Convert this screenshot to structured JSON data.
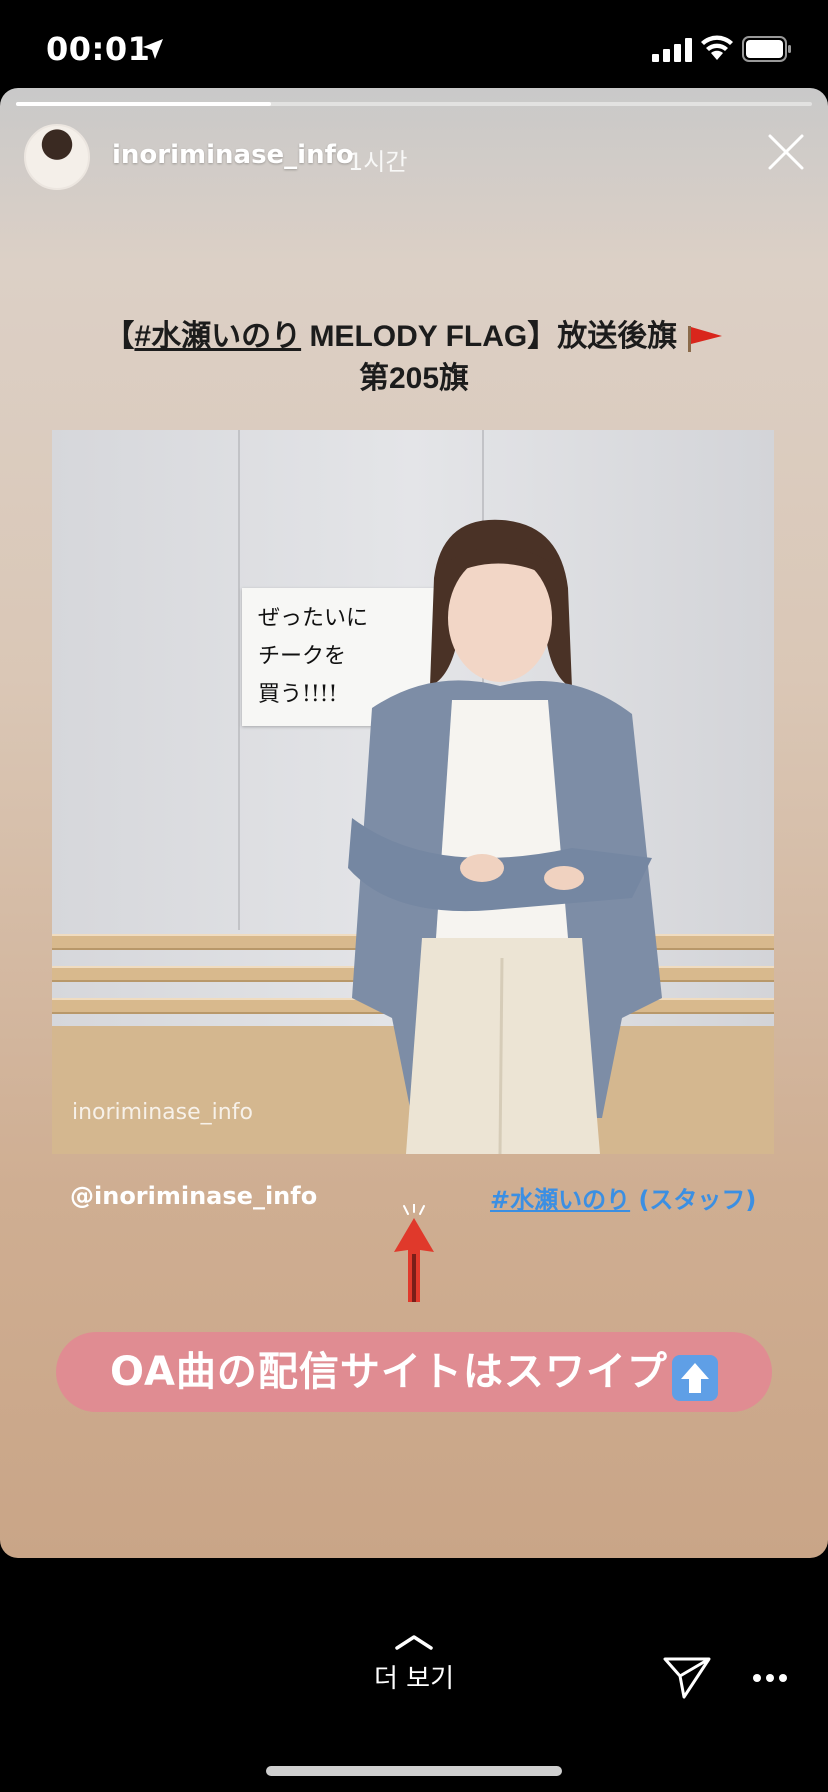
{
  "status_bar": {
    "time": "00:01"
  },
  "story": {
    "progress": 0.32,
    "username": "inoriminase_info",
    "time_ago": "1시간",
    "headline": {
      "prefix": "【",
      "hashtag": "#水瀬いのり",
      "middle": " MELODY FLAG】放送後旗",
      "line2": "第205旗"
    },
    "photo": {
      "sign_text": "ぜったいに\nチークを\n買う!!!!",
      "watermark": "inoriminase_info"
    },
    "mention": "@inoriminase_info",
    "tag": {
      "hashtag": "#水瀬いのり",
      "suffix": " (スタッフ)"
    },
    "swipe_banner": "OA曲の配信サイトはスワイプ"
  },
  "bottom_bar": {
    "see_more_label": "더 보기"
  },
  "colors": {
    "banner": "#e08c92",
    "link": "#3b8fe3",
    "arrow": "#e0392b"
  }
}
